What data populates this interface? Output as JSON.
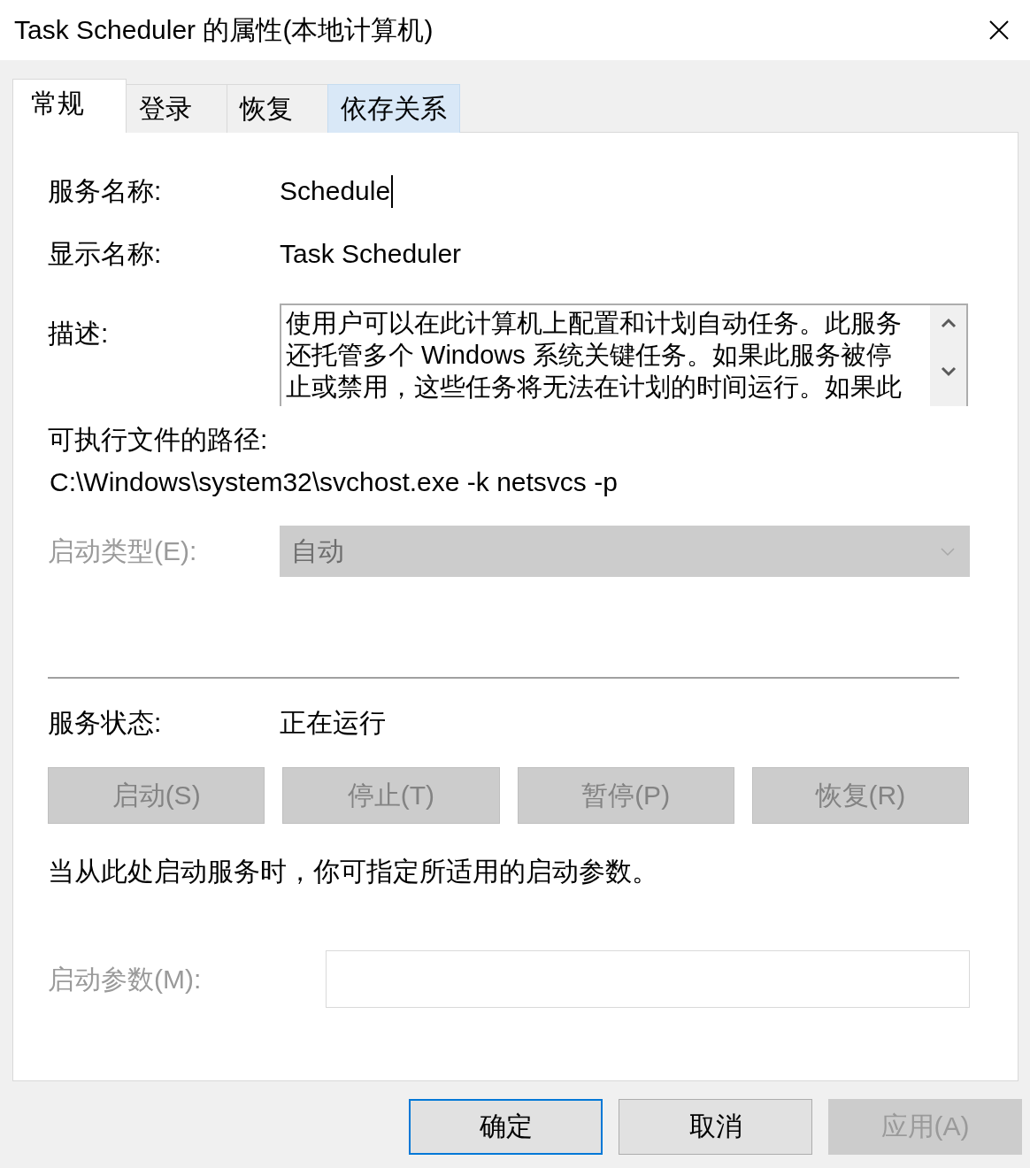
{
  "window": {
    "title": "Task Scheduler 的属性(本地计算机)"
  },
  "tabs": [
    {
      "label": "常规",
      "selected": true,
      "hovered": false
    },
    {
      "label": "登录",
      "selected": false,
      "hovered": false
    },
    {
      "label": "恢复",
      "selected": false,
      "hovered": false
    },
    {
      "label": "依存关系",
      "selected": false,
      "hovered": true
    }
  ],
  "general": {
    "service_name": {
      "label": "服务名称:",
      "value": "Schedule",
      "focused": true
    },
    "display_name": {
      "label": "显示名称:",
      "value": "Task Scheduler"
    },
    "description": {
      "label": "描述:",
      "lines": [
        "使用户可以在此计算机上配置和计划自动任务。此服务",
        "还托管多个 Windows 系统关键任务。如果此服务被停",
        "止或禁用，这些任务将无法在计划的时间运行。如果此"
      ]
    },
    "executable_path": {
      "label": "可执行文件的路径:",
      "value": "C:\\Windows\\system32\\svchost.exe -k netsvcs -p"
    },
    "startup_type": {
      "label": "启动类型(E):",
      "value": "自动",
      "disabled": true
    },
    "service_status": {
      "label": "服务状态:",
      "value": "正在运行"
    },
    "service_buttons": [
      {
        "label": "启动(S)",
        "disabled": true
      },
      {
        "label": "停止(T)",
        "disabled": true
      },
      {
        "label": "暂停(P)",
        "disabled": true
      },
      {
        "label": "恢复(R)",
        "disabled": true
      }
    ],
    "hint": "当从此处启动服务时，你可指定所适用的启动参数。",
    "start_parameters": {
      "label": "启动参数(M):",
      "disabled": true
    }
  },
  "buttons": [
    {
      "label": "确定",
      "default": true,
      "disabled": false
    },
    {
      "label": "取消",
      "default": false,
      "disabled": false
    },
    {
      "label": "应用(A)",
      "default": false,
      "disabled": true
    }
  ]
}
